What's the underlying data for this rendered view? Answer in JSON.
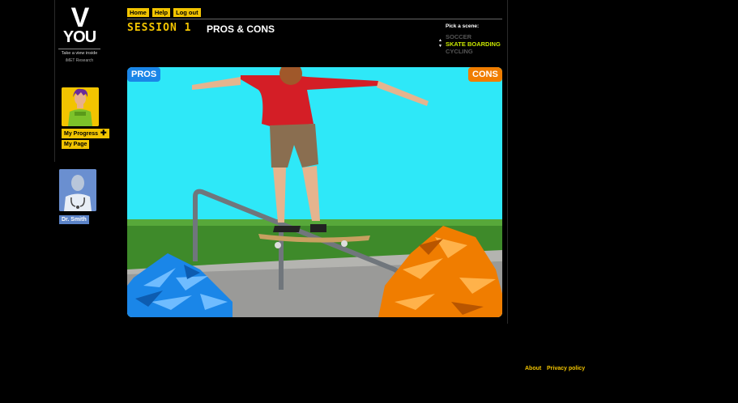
{
  "logo": {
    "v": "V",
    "you": "YOU",
    "tagline": "Take a view inside",
    "org": "iMET Research"
  },
  "sidebar": {
    "progress_label": "My Progress",
    "page_label": "My Page",
    "doctor_label": "Dr. Smith"
  },
  "nav": {
    "home": "Home",
    "help": "Help",
    "logout": "Log out"
  },
  "session": {
    "label": "SESSION 1",
    "title": "PROS & CONS"
  },
  "scene_picker": {
    "label": "Pick a scene:",
    "options": [
      "SOCCER",
      "SKATE BOARDING",
      "CYCLING"
    ],
    "selected": "SKATE BOARDING"
  },
  "stage": {
    "pros_label": "PROS",
    "cons_label": "CONS"
  },
  "footer": {
    "about": "About",
    "privacy": "Privacy policy"
  },
  "colors": {
    "accent": "#f2c400",
    "pros": "#1a86e8",
    "cons": "#f07d00",
    "sky": "#2ee8f8",
    "selected_scene": "#c8e600"
  }
}
